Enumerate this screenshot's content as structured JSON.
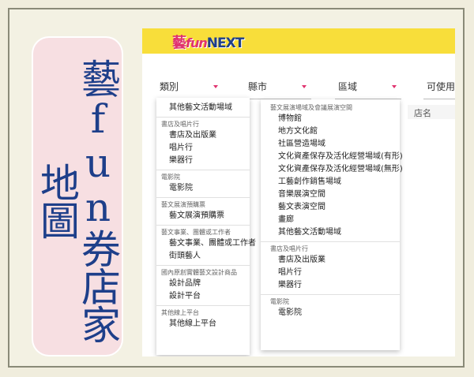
{
  "sidebar_title": "藝fun券店家地圖",
  "logo": {
    "part1": "藝",
    "part2": "fun",
    "part3": "NEXT"
  },
  "filters": [
    {
      "label": "類別"
    },
    {
      "label": "縣市"
    },
    {
      "label": "區域"
    },
    {
      "label": "可使用"
    }
  ],
  "table_header": "店名",
  "menu_left": {
    "top_item": "其他藝文活動場域",
    "groups": [
      {
        "title": "書店及唱片行",
        "items": [
          "書店及出版業",
          "唱片行",
          "樂器行"
        ]
      },
      {
        "title": "電影院",
        "items": [
          "電影院"
        ]
      },
      {
        "title": "藝文展演預購票",
        "items": [
          "藝文展演預購票"
        ]
      },
      {
        "title": "藝文事業、團體或工作者",
        "items": [
          "藝文事業、團體或工作者",
          "街頭藝人"
        ]
      },
      {
        "title": "國內原創實體藝文設計商品",
        "items": [
          "設計品牌",
          "設計平台"
        ]
      },
      {
        "title": "其他線上平台",
        "items": [
          "其他線上平台"
        ]
      }
    ]
  },
  "menu_right": {
    "groups": [
      {
        "title": "藝文展演場域及會議展演空間",
        "items": [
          "博物館",
          "地方文化館",
          "社區營造場域",
          "文化資產保存及活化經營場域(有形)",
          "文化資產保存及活化經營場域(無形)",
          "工藝創作銷售場域",
          "音樂展演空間",
          "藝文表演空間",
          "畫廊",
          "其他藝文活動場域"
        ]
      },
      {
        "title": "書店及唱片行",
        "items": [
          "書店及出版業",
          "唱片行",
          "樂器行"
        ]
      },
      {
        "title": "電影院",
        "items": [
          "電影院"
        ]
      }
    ]
  }
}
